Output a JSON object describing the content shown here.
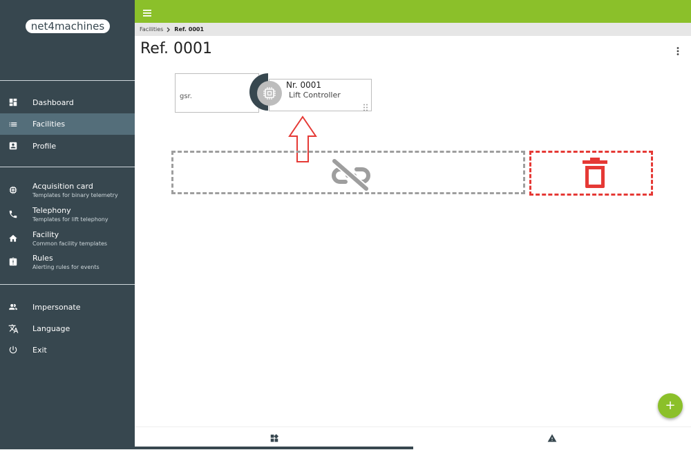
{
  "brand": {
    "logo_text": "net4machines",
    "accent": "#8bc02a",
    "sidebar_bg": "#37474f",
    "danger": "#e53935"
  },
  "sidebar": {
    "primary": [
      {
        "label": "Dashboard",
        "icon": "dashboard-icon"
      },
      {
        "label": "Facilities",
        "icon": "list-icon",
        "active": true
      },
      {
        "label": "Profile",
        "icon": "person-badge-icon"
      }
    ],
    "templates": [
      {
        "label": "Acquisition card",
        "sub": "Templates for binary telemetry",
        "icon": "chip-icon"
      },
      {
        "label": "Telephony",
        "sub": "Templates for lift telephony",
        "icon": "phone-icon"
      },
      {
        "label": "Facility",
        "sub": "Common facility templates",
        "icon": "home-icon"
      },
      {
        "label": "Rules",
        "sub": "Alerting rules for events",
        "icon": "alert-clipboard-icon"
      }
    ],
    "system": [
      {
        "label": "Impersonate",
        "icon": "people-icon"
      },
      {
        "label": "Language",
        "icon": "translate-icon"
      },
      {
        "label": "Exit",
        "icon": "power-icon"
      }
    ]
  },
  "breadcrumb": {
    "parent": "Facilities",
    "current": "Ref. 0001"
  },
  "page": {
    "title": "Ref. 0001"
  },
  "cards": {
    "back_text": "gsr.",
    "front_title": "Nr. 0001",
    "front_subtitle": "Lift Controller"
  },
  "dropzones": {
    "unlink_icon": "link-off-icon",
    "delete_icon": "trash-icon"
  },
  "fab": {
    "label": "+"
  },
  "bottom_nav": {
    "tabs": [
      {
        "icon": "widgets-icon",
        "active": true
      },
      {
        "icon": "warning-icon"
      }
    ]
  }
}
